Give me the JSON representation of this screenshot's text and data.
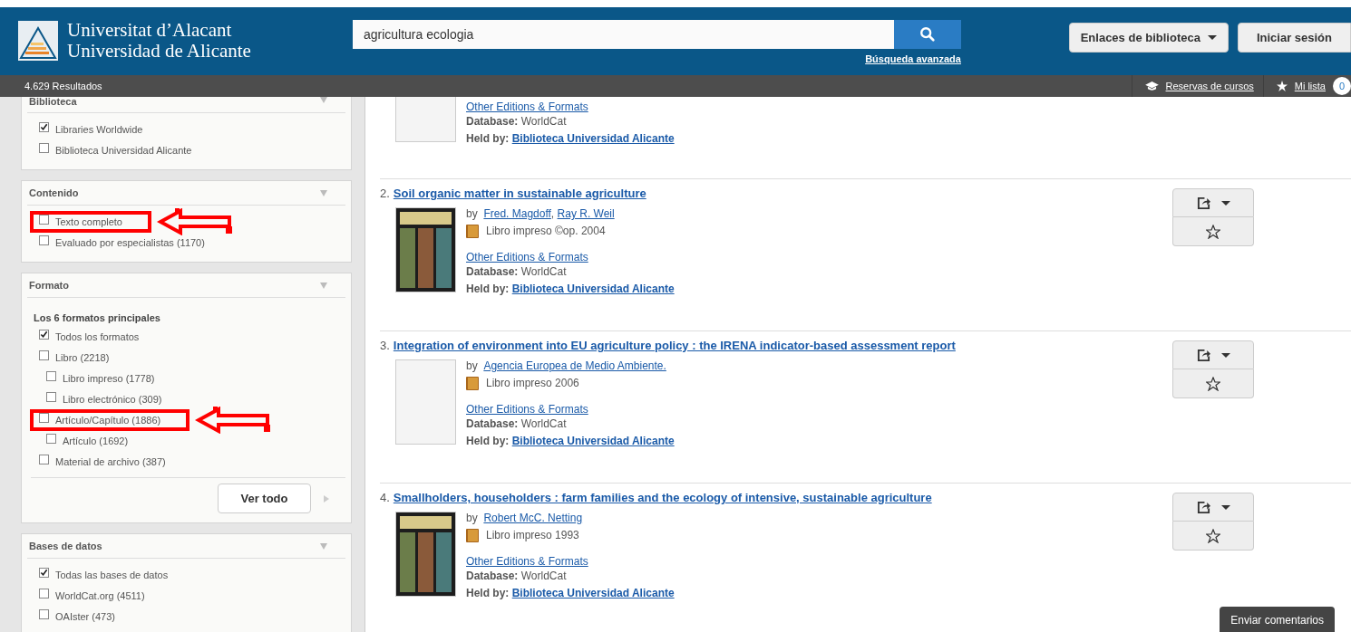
{
  "header": {
    "logo_lines": [
      "Universitat d’Alacant",
      "Universidad de Alicante"
    ],
    "search": {
      "value": "agricultura ecologia"
    },
    "advanced_link": "Búsqueda avanzada",
    "menus": [
      {
        "label": "Enlaces de biblioteca",
        "kind": "dropdown"
      },
      {
        "label": "Iniciar sesión",
        "kind": "button"
      }
    ]
  },
  "toolbar": {
    "results_count": "4.629 Resultados",
    "links": [
      {
        "label": "Reservas de cursos",
        "kind": "courses"
      },
      {
        "label": "Mi lista",
        "kind": "list",
        "badge": "0"
      }
    ]
  },
  "filters": [
    {
      "title": "Biblioteca",
      "options": [
        {
          "label": "Libraries Worldwide",
          "checked": true,
          "highlighted": false
        },
        {
          "label": "Biblioteca Universidad Alicante",
          "checked": false,
          "highlighted": false
        }
      ]
    },
    {
      "title": "Contenido",
      "options": [
        {
          "label": "Texto completo",
          "checked": false,
          "highlighted": true
        },
        {
          "label": "Evaluado por especialistas (1170)",
          "checked": false,
          "highlighted": false
        }
      ]
    },
    {
      "title": "Formato",
      "subtitle": "Los 6 formatos principales",
      "options": [
        {
          "label": "Todos los formatos",
          "checked": true,
          "highlighted": false
        },
        {
          "label": "Libro (2218)",
          "checked": false,
          "highlighted": false,
          "children": [
            {
              "label": "Libro impreso (1778)",
              "checked": false,
              "highlighted": false
            },
            {
              "label": "Libro electrónico (309)",
              "checked": false,
              "highlighted": false
            }
          ]
        },
        {
          "label": "Artículo/Capítulo (1886)",
          "checked": false,
          "highlighted": true,
          "children": [
            {
              "label": "Artículo (1692)",
              "checked": false,
              "highlighted": false
            }
          ]
        },
        {
          "label": "Material de archivo (387)",
          "checked": false,
          "highlighted": false
        }
      ],
      "more_button": "Ver todo"
    },
    {
      "title": "Bases de datos",
      "options": [
        {
          "label": "Todas las bases de datos",
          "checked": true,
          "highlighted": false
        },
        {
          "label": "WorldCat.org (4511)",
          "checked": false,
          "highlighted": false
        },
        {
          "label": "OAIster (473)",
          "checked": false,
          "highlighted": false
        }
      ]
    }
  ],
  "results": [
    {
      "has_cover": false,
      "other_editions": "Other Editions & Formats",
      "database": {
        "label": "Database:",
        "value": "WorldCat"
      },
      "held_by": {
        "label": "Held by:",
        "value": "Biblioteca Universidad Alicante"
      }
    },
    {
      "number": "2.",
      "title": "Soil organic matter in sustainable agriculture",
      "authors_prefix": "by",
      "authors": [
        "Fred. Magdoff",
        "Ray R. Weil"
      ],
      "author_separator": ",",
      "format": "Libro impreso ©op. 2004",
      "has_cover": true,
      "other_editions": "Other Editions & Formats",
      "database": {
        "label": "Database:",
        "value": "WorldCat"
      },
      "held_by": {
        "label": "Held by:",
        "value": "Biblioteca Universidad Alicante"
      }
    },
    {
      "number": "3.",
      "title": "Integration of environment into EU agriculture policy : the IRENA indicator-based assessment report",
      "authors_prefix": "by",
      "authors": [
        "Agencia Europea de Medio Ambiente."
      ],
      "format": "Libro impreso 2006",
      "has_cover": false,
      "other_editions": "Other Editions & Formats",
      "database": {
        "label": "Database:",
        "value": "WorldCat"
      },
      "held_by": {
        "label": "Held by:",
        "value": "Biblioteca Universidad Alicante"
      }
    },
    {
      "number": "4.",
      "title": "Smallholders, householders : farm families and the ecology of intensive, sustainable agriculture",
      "authors_prefix": "by",
      "authors": [
        "Robert McC. Netting"
      ],
      "format": "Libro impreso 1993",
      "has_cover": true,
      "other_editions": "Other Editions & Formats",
      "database": {
        "label": "Database:",
        "value": "WorldCat"
      },
      "held_by": {
        "label": "Held by:",
        "value": "Biblioteca Universidad Alicante"
      }
    }
  ],
  "feedback_button": "Enviar comentarios"
}
